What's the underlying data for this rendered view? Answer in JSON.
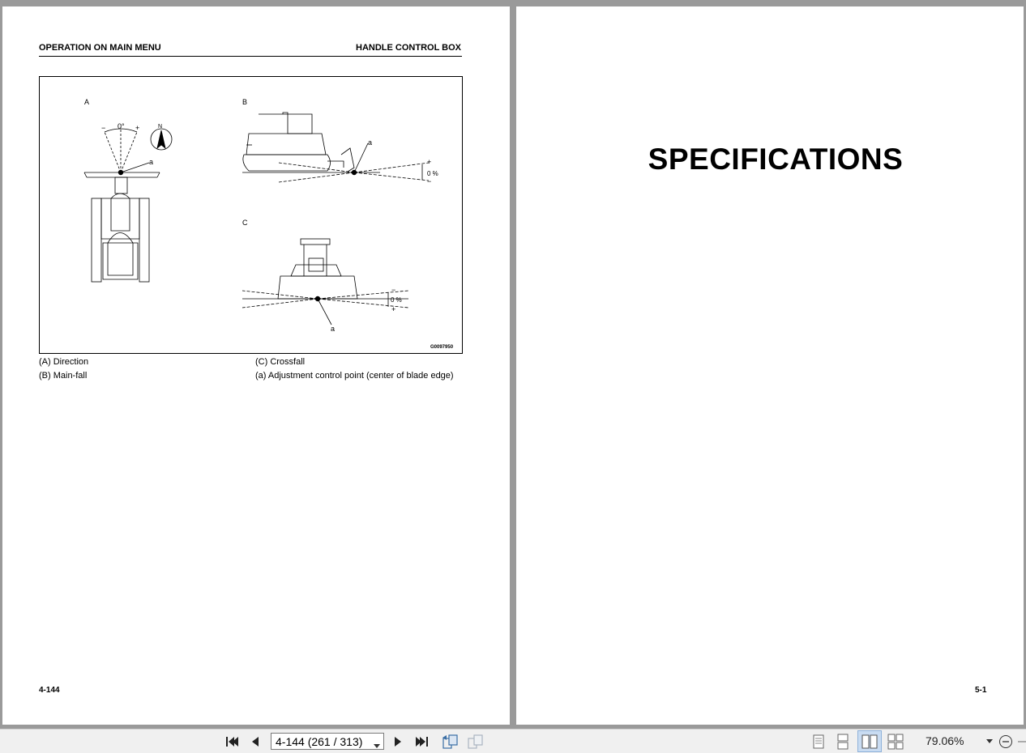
{
  "left_page": {
    "header_left": "OPERATION ON MAIN MENU",
    "header_right": "HANDLE CONTROL BOX",
    "figure": {
      "label_a": "A",
      "label_b": "B",
      "label_c": "C",
      "angle_label": "0°",
      "minus": "−",
      "plus": "+",
      "north": "N",
      "point_label": "a",
      "percent_label": "0 %",
      "figure_code": "G0097950"
    },
    "captions": {
      "a": "(A) Direction",
      "b": "(B) Main-fall",
      "c": "(C) Crossfall",
      "point": "(a) Adjustment control point (center of blade edge)"
    },
    "page_number": "4-144"
  },
  "right_page": {
    "title": "SPECIFICATIONS",
    "page_number": "5-1"
  },
  "toolbar": {
    "page_field": "4-144 (261 / 313)",
    "zoom": "79.06%",
    "icons": [
      "first-page-icon",
      "prev-page-icon",
      "next-page-icon",
      "last-page-icon",
      "go-back-view-icon",
      "go-forward-view-icon",
      "single-page-view-icon",
      "continuous-view-icon",
      "two-page-view-icon",
      "continuous-two-page-view-icon",
      "zoom-dropdown-icon",
      "zoom-out-icon"
    ]
  }
}
